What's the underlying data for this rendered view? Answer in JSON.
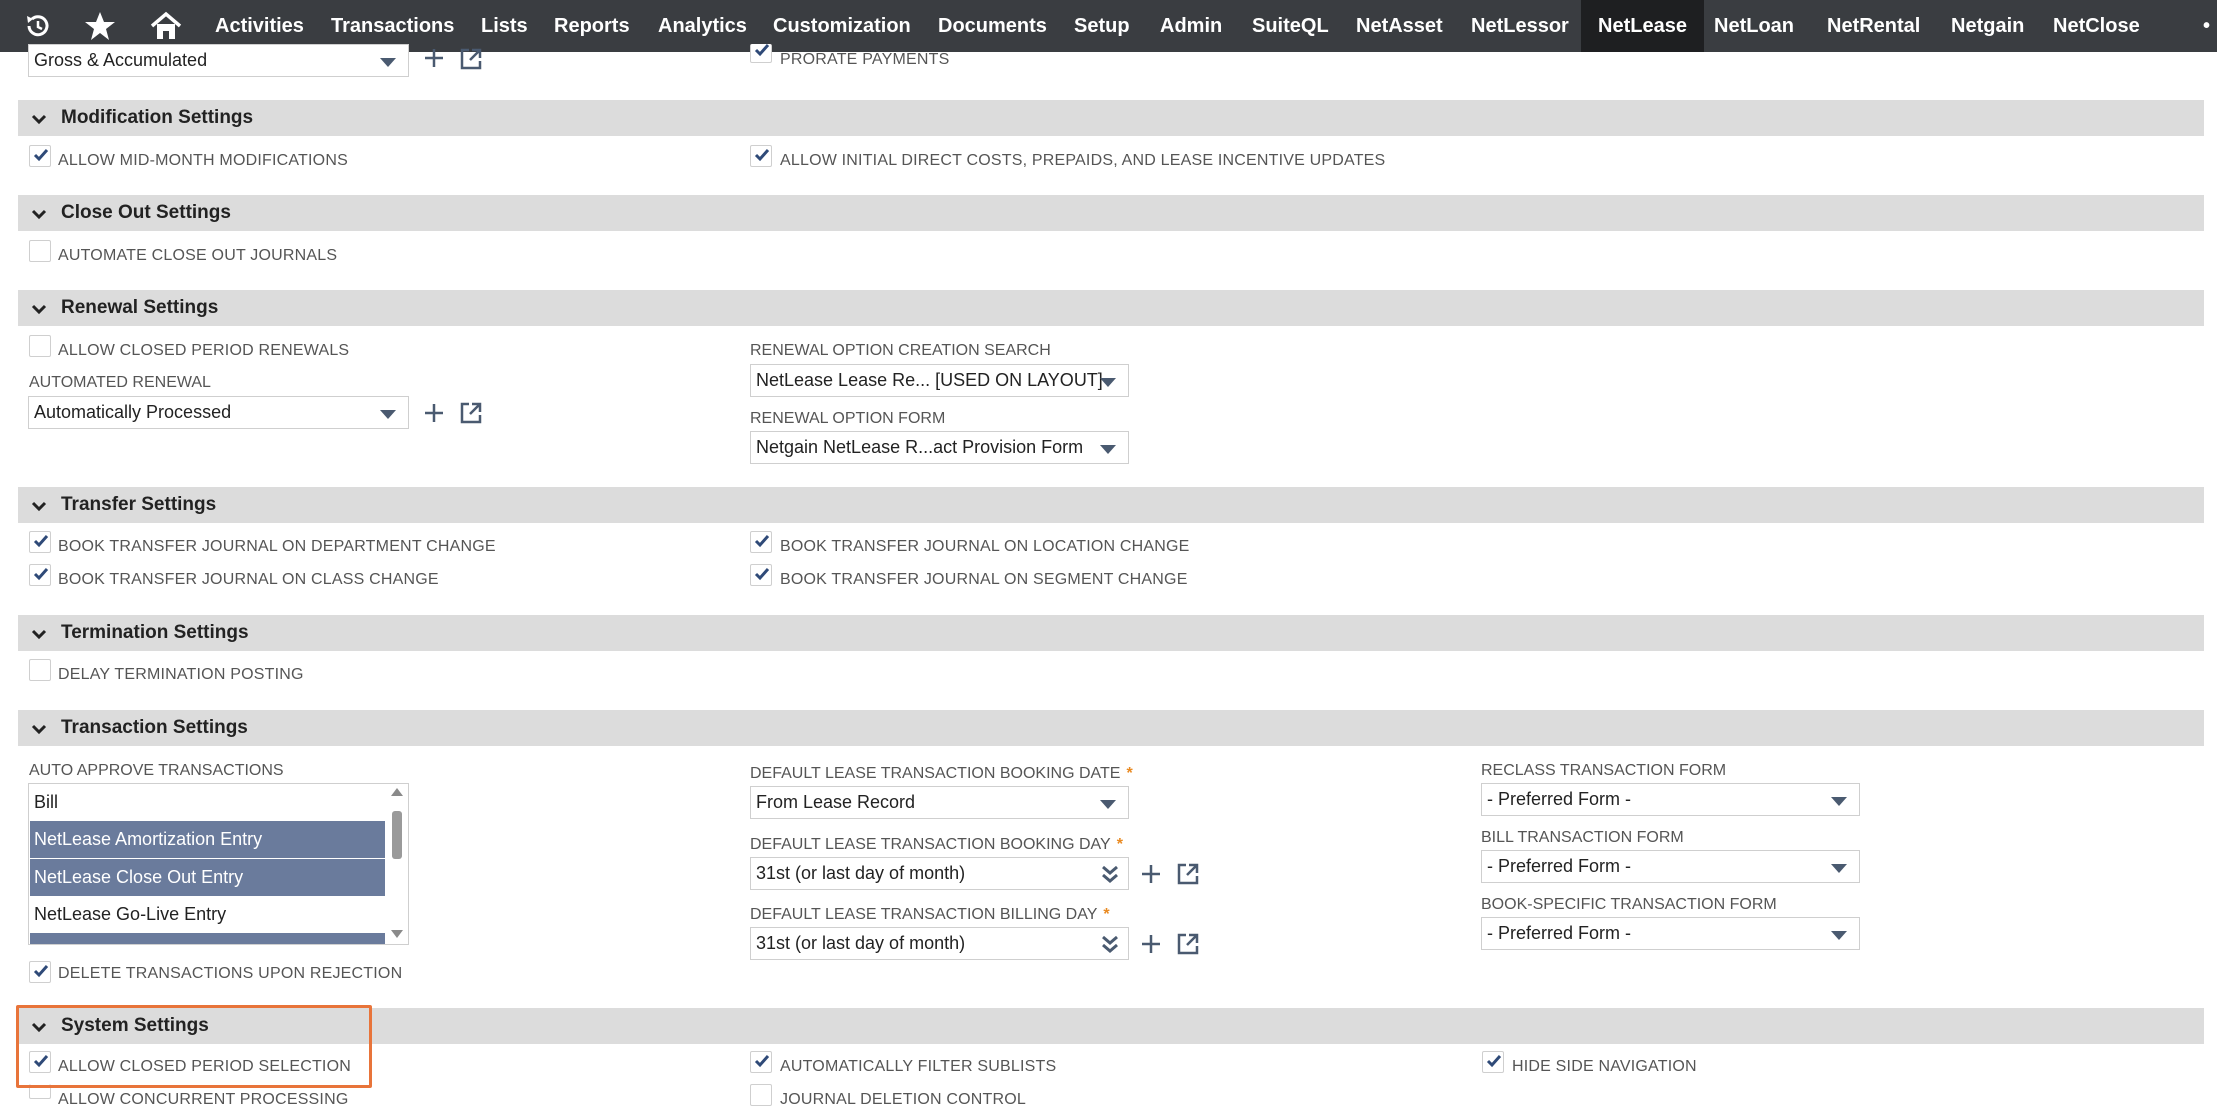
{
  "nav": {
    "items": [
      "Activities",
      "Transactions",
      "Lists",
      "Reports",
      "Analytics",
      "Customization",
      "Documents",
      "Setup",
      "Admin",
      "SuiteQL",
      "NetAsset",
      "NetLessor",
      "NetLease",
      "NetLoan",
      "NetRental",
      "Netgain",
      "NetClose"
    ],
    "active": "NetLease",
    "more": "•"
  },
  "top": {
    "depreciation_value": "Gross & Accumulated",
    "prorate_label": "PRORATE PAYMENTS",
    "prorate_checked": true
  },
  "sections": {
    "modification": {
      "title": "Modification Settings",
      "allow_mid_month": "ALLOW MID-MONTH MODIFICATIONS",
      "allow_initial_direct": "ALLOW INITIAL DIRECT COSTS, PREPAIDS, AND LEASE INCENTIVE UPDATES"
    },
    "closeout": {
      "title": "Close Out Settings",
      "automate": "AUTOMATE CLOSE OUT JOURNALS"
    },
    "renewal": {
      "title": "Renewal Settings",
      "allow_closed": "ALLOW CLOSED PERIOD RENEWALS",
      "automated_label": "AUTOMATED RENEWAL",
      "automated_value": "Automatically Processed",
      "creation_search_label": "RENEWAL OPTION CREATION SEARCH",
      "creation_search_value": "NetLease Lease Re... [USED ON LAYOUT]",
      "form_label": "RENEWAL OPTION FORM",
      "form_value": "Netgain NetLease R...act Provision Form"
    },
    "transfer": {
      "title": "Transfer Settings",
      "department": "BOOK TRANSFER JOURNAL ON DEPARTMENT CHANGE",
      "class": "BOOK TRANSFER JOURNAL ON CLASS CHANGE",
      "location": "BOOK TRANSFER JOURNAL ON LOCATION CHANGE",
      "segment": "BOOK TRANSFER JOURNAL ON SEGMENT CHANGE"
    },
    "termination": {
      "title": "Termination Settings",
      "delay": "DELAY TERMINATION POSTING"
    },
    "transaction": {
      "title": "Transaction Settings",
      "auto_approve_label": "AUTO APPROVE TRANSACTIONS",
      "auto_approve_options": [
        "Bill",
        "NetLease Amortization Entry",
        "NetLease Close Out Entry",
        "NetLease Go-Live Entry",
        ""
      ],
      "booking_date_label": "DEFAULT LEASE TRANSACTION BOOKING DATE",
      "booking_date_value": "From Lease Record",
      "booking_day_label": "DEFAULT LEASE TRANSACTION BOOKING DAY",
      "booking_day_value": "31st (or last day of month)",
      "billing_day_label": "DEFAULT LEASE TRANSACTION BILLING DAY",
      "billing_day_value": "31st (or last day of month)",
      "required_mark": "*",
      "reclass_label": "RECLASS TRANSACTION FORM",
      "reclass_value": "- Preferred Form -",
      "bill_label": "BILL TRANSACTION FORM",
      "bill_value": "- Preferred Form -",
      "book_specific_label": "BOOK-SPECIFIC TRANSACTION FORM",
      "book_specific_value": "- Preferred Form -",
      "delete_upon_rejection": "DELETE TRANSACTIONS UPON REJECTION"
    },
    "system": {
      "title": "System Settings",
      "allow_closed_selection": "ALLOW CLOSED PERIOD SELECTION",
      "allow_concurrent": "ALLOW CONCURRENT PROCESSING",
      "auto_filter": "AUTOMATICALLY FILTER SUBLISTS",
      "journal_deletion": "JOURNAL DELETION CONTROL",
      "hide_side_nav": "HIDE SIDE NAVIGATION"
    }
  },
  "colors": {
    "nav_bg": "#3a3d41",
    "nav_active_bg": "#1e1f21",
    "section_bg": "#dcdcdc",
    "selected_option": "#6a7b9c",
    "check_color": "#2f4a78",
    "highlight": "#e8743a",
    "required": "#e98a22"
  }
}
